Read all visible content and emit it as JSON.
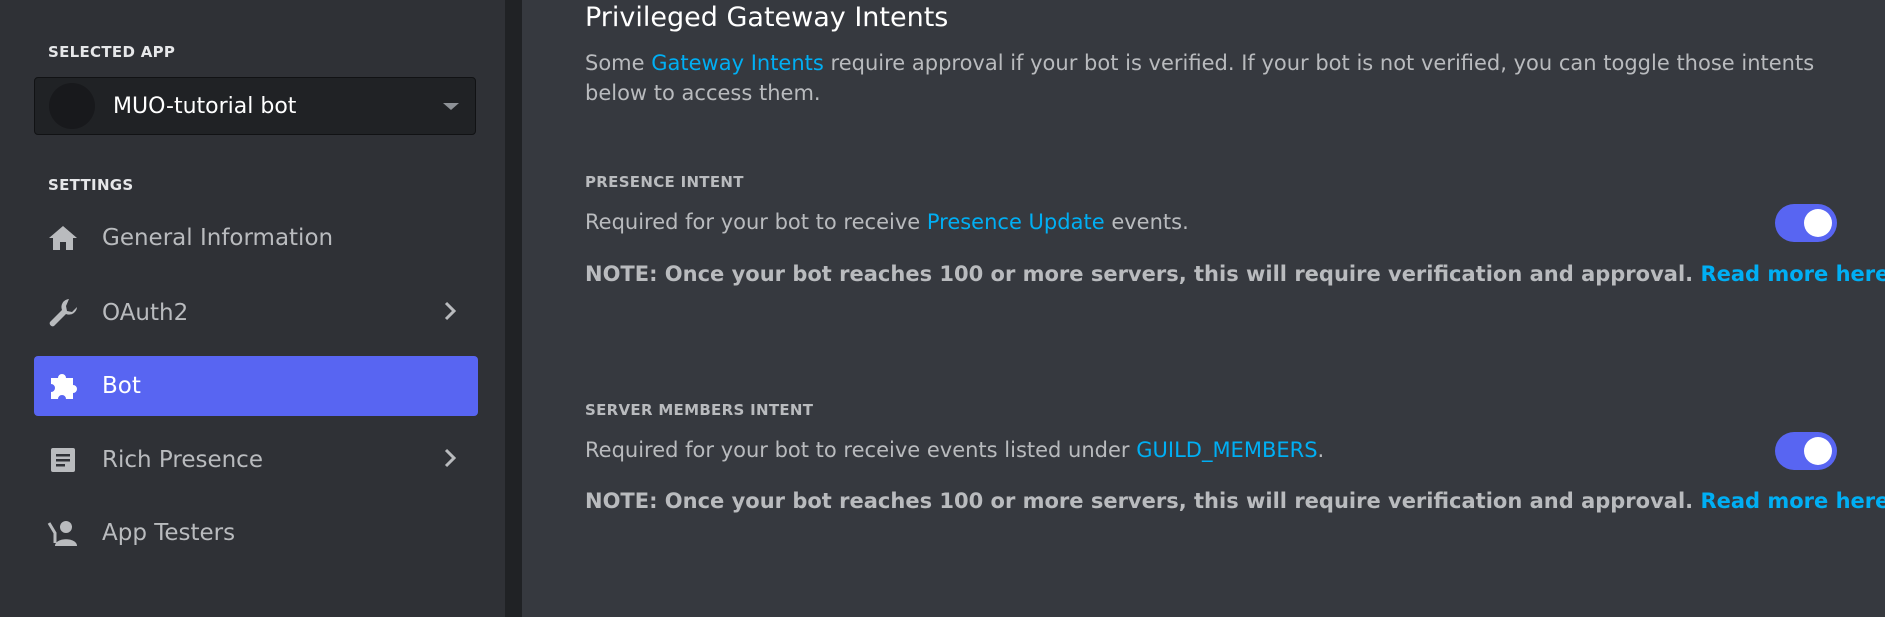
{
  "sidebar": {
    "selected_app_heading": "SELECTED APP",
    "app_name": "MUO-tutorial bot",
    "settings_heading": "SETTINGS",
    "items": [
      {
        "label": "General Information",
        "icon": "home-icon"
      },
      {
        "label": "OAuth2",
        "icon": "wrench-icon"
      },
      {
        "label": "Bot",
        "icon": "puzzle-icon"
      },
      {
        "label": "Rich Presence",
        "icon": "document-icon"
      },
      {
        "label": "App Testers",
        "icon": "person-icon"
      }
    ]
  },
  "main": {
    "title": "Privileged Gateway Intents",
    "desc_prefix": "Some",
    "desc_link": "Gateway Intents",
    "desc_suffix": "require approval if your bot is verified. If your bot is not verified, you can toggle those intents below to access them.",
    "presence": {
      "heading": "PRESENCE INTENT",
      "req_prefix": "Required for your bot to receive",
      "req_link": "Presence Update",
      "req_suffix": "events.",
      "note": "NOTE: Once your bot reaches 100 or more servers, this will require verification and approval.",
      "note_link": "Read more here",
      "enabled": true
    },
    "members": {
      "heading": "SERVER MEMBERS INTENT",
      "req_prefix": "Required for your bot to receive events listed under",
      "req_link": "GUILD_MEMBERS",
      "req_suffix": ".",
      "note": "NOTE: Once your bot reaches 100 or more servers, this will require verification and approval.",
      "note_link": "Read more here",
      "enabled": true
    }
  },
  "colors": {
    "accent": "#5865f2",
    "link": "#00aff4",
    "background": "#36393f",
    "sidebar": "#2f3136"
  }
}
